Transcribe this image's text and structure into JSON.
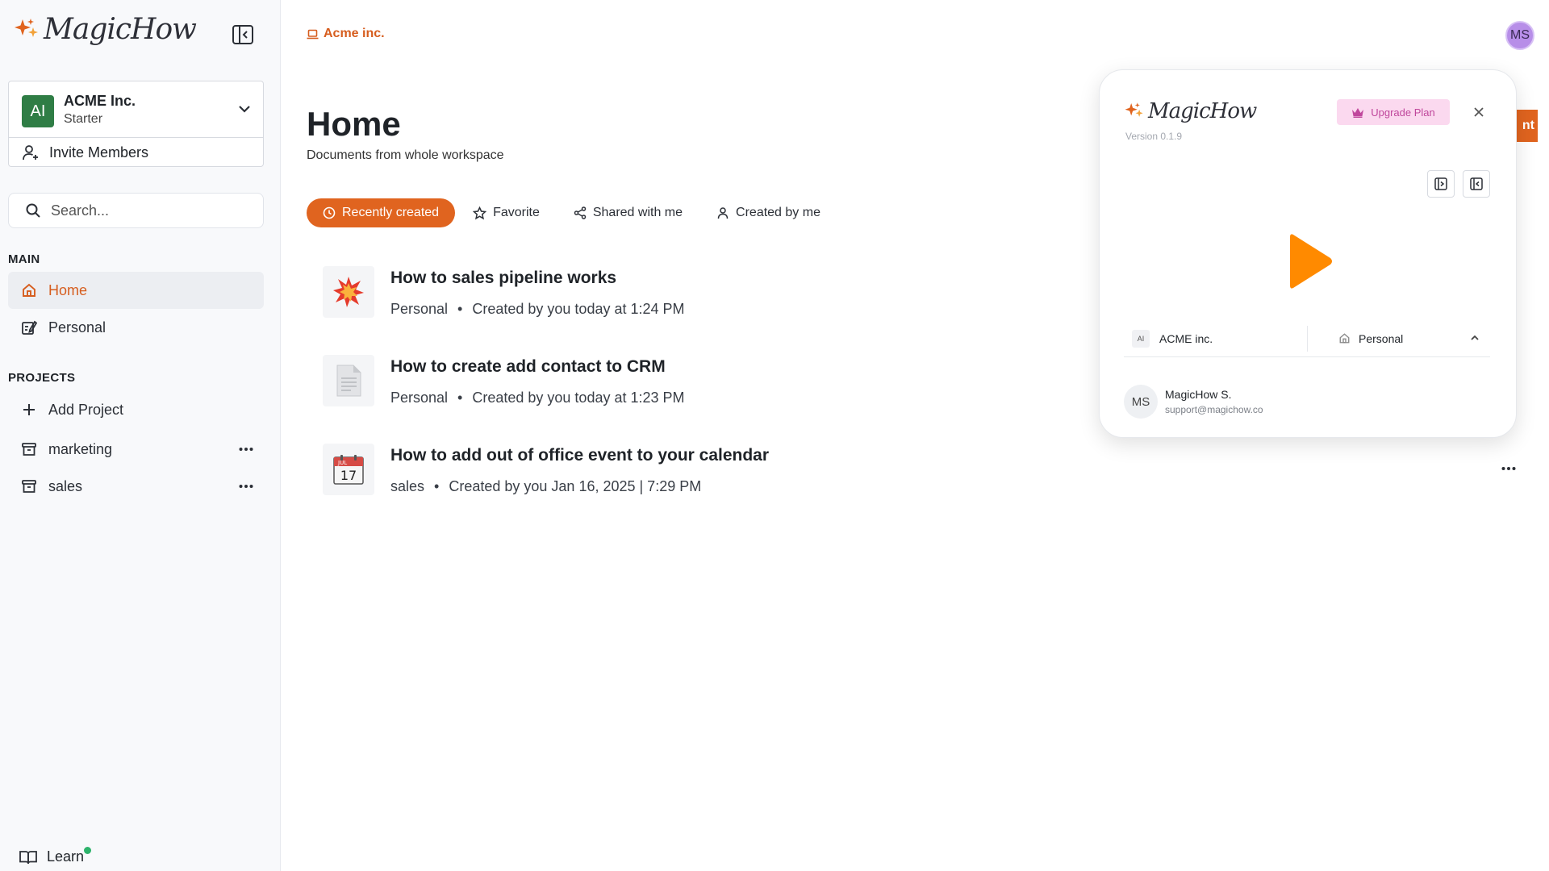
{
  "app": {
    "logo_text": "MagicHow"
  },
  "sidebar": {
    "workspace": {
      "avatar": "AI",
      "name": "ACME Inc.",
      "plan": "Starter"
    },
    "invite_label": "Invite Members",
    "search_placeholder": "Search...",
    "main_label": "MAIN",
    "main_items": [
      {
        "label": "Home",
        "icon": "home-icon",
        "active": true
      },
      {
        "label": "Personal",
        "icon": "edit-note-icon",
        "active": false
      }
    ],
    "projects_label": "PROJECTS",
    "add_project_label": "Add Project",
    "projects": [
      {
        "label": "marketing",
        "icon": "archive-box-icon"
      },
      {
        "label": "sales",
        "icon": "archive-box-icon"
      }
    ],
    "learn_label": "Learn"
  },
  "header": {
    "breadcrumb": "Acme inc.",
    "user_initials": "MS"
  },
  "main": {
    "title": "Home",
    "subtitle": "Documents from whole workspace",
    "tabs": [
      {
        "label": "Recently created",
        "icon": "clock-icon",
        "active": true
      },
      {
        "label": "Favorite",
        "icon": "star-icon",
        "active": false
      },
      {
        "label": "Shared with me",
        "icon": "share-icon",
        "active": false
      },
      {
        "label": "Created by me",
        "icon": "user-icon",
        "active": false
      }
    ],
    "documents": [
      {
        "title": "How to sales pipeline works",
        "project": "Personal",
        "created": "Created by you today at 1:24 PM",
        "thumb": "explosion-icon"
      },
      {
        "title": "How to create add contact to CRM",
        "project": "Personal",
        "created": "Created by you today at 1:23 PM",
        "thumb": "document-icon"
      },
      {
        "title": "How to add out of office event to your calendar",
        "project": "sales",
        "created": "Created by you Jan 16, 2025 | 7:29 PM",
        "thumb": "calendar-icon",
        "calendar_month": "JUL",
        "calendar_day": "17"
      }
    ],
    "orange_tab_text": "nt"
  },
  "panel": {
    "logo_text": "MagicHow",
    "version": "Version 0.1.9",
    "upgrade_label": "Upgrade Plan",
    "workspace_mini": "AI",
    "workspace_name": "ACME inc.",
    "project_name": "Personal",
    "user_initials": "MS",
    "user_name": "MagicHow S.",
    "user_email": "support@magichow.co"
  },
  "colors": {
    "accent": "#e0641f",
    "accent_text": "#d65d1e",
    "workspace_avatar": "#2f7d45",
    "play": "#ff8a00",
    "upgrade_bg": "#fbd9ef",
    "upgrade_text": "#c0479c",
    "learn_dot": "#2db36b"
  }
}
